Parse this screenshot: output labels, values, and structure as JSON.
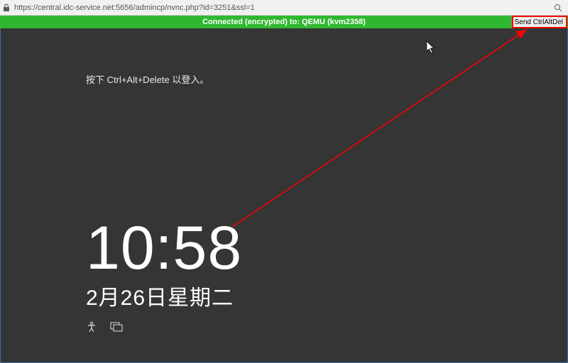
{
  "browser": {
    "url": "https://central.idc-service.net:5656/admincp/nvnc.php?id=3251&ssl=1"
  },
  "vnc": {
    "status_text": "Connected (encrypted) to: QEMU (kvm2358)",
    "send_cad_label": "Send CtrlAltDel"
  },
  "lockscreen": {
    "prompt": "按下 Ctrl+Alt+Delete 以登入。",
    "time": "10:58",
    "date": "2月26日星期二"
  }
}
